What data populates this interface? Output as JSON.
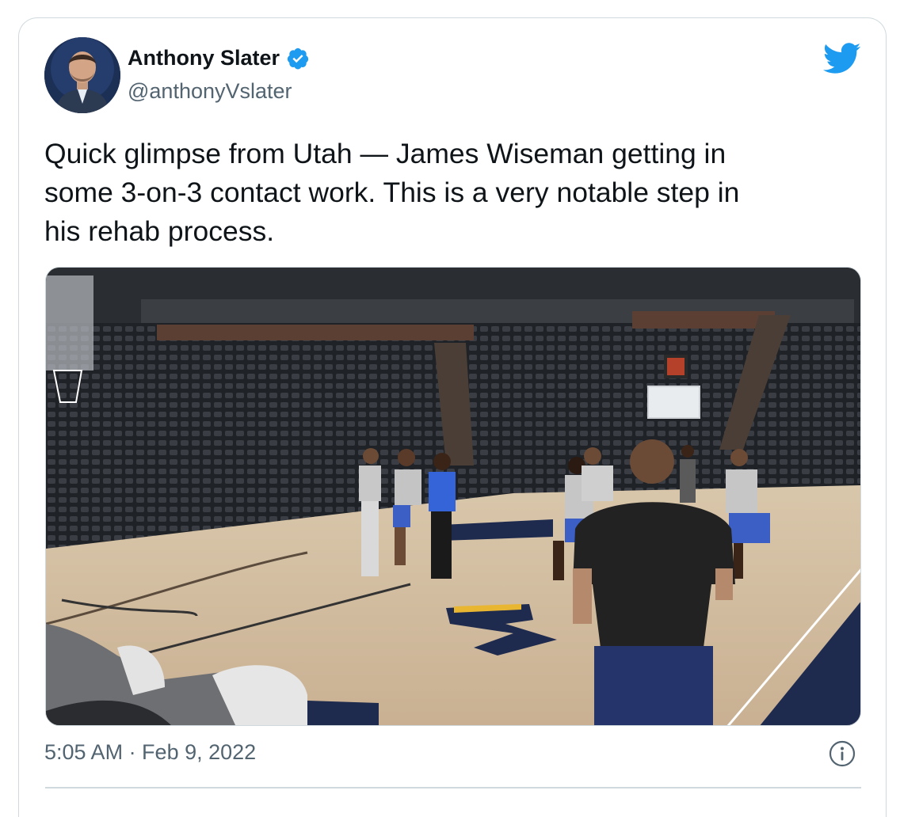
{
  "tweet": {
    "author_name": "Anthony Slater",
    "handle": "@anthonyVslater",
    "text": "Quick glimpse from Utah — James Wiseman getting in\nsome 3-on-3 contact work. This is a very notable step in\nhis rehab process.",
    "timestamp": "5:05 AM · Feb 9, 2022",
    "verified": true
  },
  "icons": {
    "verified": "verified-badge-icon",
    "brand": "twitter-bird-icon",
    "info": "info-icon"
  },
  "colors": {
    "brand": "#1d9bf0",
    "text": "#0f1419",
    "muted": "#536471",
    "border": "#cfd9de"
  }
}
